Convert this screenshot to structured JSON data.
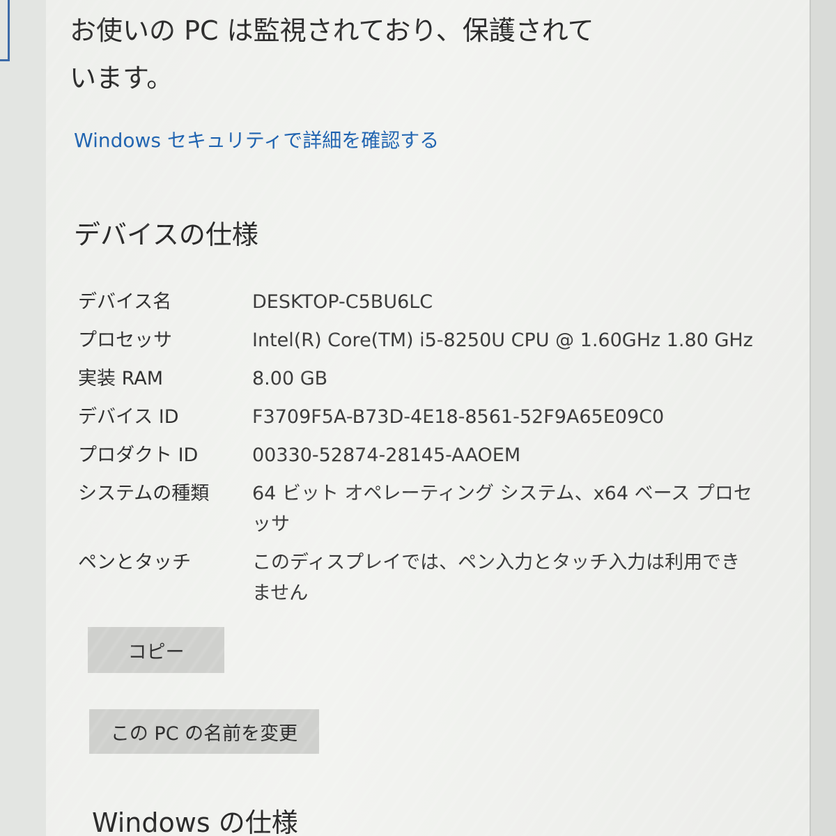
{
  "protection_status": {
    "message": "お使いの PC は監視されており、保護されています。",
    "link": "Windows セキュリティで詳細を確認する"
  },
  "device_specs": {
    "title": "デバイスの仕様",
    "rows": [
      {
        "label": "デバイス名",
        "value": "DESKTOP-C5BU6LC"
      },
      {
        "label": "プロセッサ",
        "value": "Intel(R) Core(TM) i5-8250U CPU @ 1.60GHz   1.80 GHz"
      },
      {
        "label": "実装 RAM",
        "value": "8.00 GB"
      },
      {
        "label": "デバイス ID",
        "value": "F3709F5A-B73D-4E18-8561-52F9A65E09C0"
      },
      {
        "label": "プロダクト ID",
        "value": "00330-52874-28145-AAOEM"
      },
      {
        "label": "システムの種類",
        "value": "64 ビット オペレーティング システム、x64 ベース プロセッサ"
      },
      {
        "label": "ペンとタッチ",
        "value": "このディスプレイでは、ペン入力とタッチ入力は利用できません"
      }
    ],
    "copy_button": "コピー",
    "rename_button": "この PC の名前を変更"
  },
  "windows_specs": {
    "title": "Windows の仕様"
  }
}
